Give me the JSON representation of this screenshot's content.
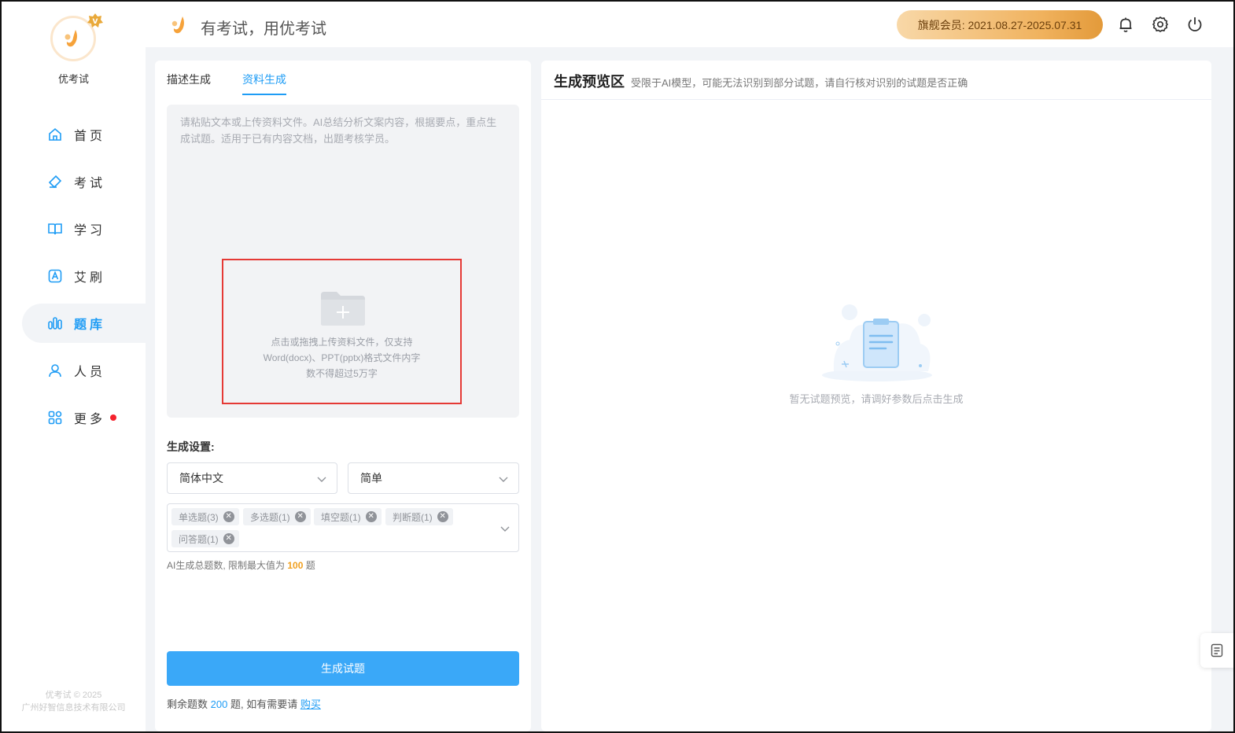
{
  "app": {
    "name": "优考试",
    "slogan": "有考试，用优考试",
    "copyright_line1": "优考试 © 2025",
    "copyright_line2": "广州好智信息技术有限公司"
  },
  "header": {
    "vip_text": "旗舰会员: 2021.08.27-2025.07.31",
    "icons": [
      "bell-icon",
      "gear-icon",
      "power-icon"
    ]
  },
  "sidebar": {
    "items": [
      {
        "label": "首页",
        "icon": "home-icon",
        "active": false
      },
      {
        "label": "考试",
        "icon": "eraser-icon",
        "active": false
      },
      {
        "label": "学习",
        "icon": "book-icon",
        "active": false
      },
      {
        "label": "艾刷",
        "icon": "a-letter-icon",
        "active": false
      },
      {
        "label": "题库",
        "icon": "bars-icon",
        "active": true
      },
      {
        "label": "人员",
        "icon": "user-icon",
        "active": false
      },
      {
        "label": "更多",
        "icon": "apps-icon",
        "active": false,
        "dot": true
      }
    ]
  },
  "left": {
    "tabs": [
      {
        "label": "描述生成",
        "active": false
      },
      {
        "label": "资料生成",
        "active": true
      }
    ],
    "placeholder": "请粘贴文本或上传资料文件。AI总结分析文案内容，根据要点，重点生成试题。适用于已有内容文档，出题考核学员。",
    "upload": {
      "line1": "点击或拖拽上传资料文件，仅支持",
      "line2": "Word(docx)、PPT(pptx)格式文件内字",
      "line3": "数不得超过5万字"
    },
    "settings_label": "生成设置:",
    "language_select": "简体中文",
    "difficulty_select": "简单",
    "tags": [
      "单选题(3)",
      "多选题(1)",
      "填空题(1)",
      "判断题(1)",
      "问答题(1)"
    ],
    "hint_prefix": "AI生成总题数, 限制最大值为",
    "hint_num": "100",
    "hint_suffix": "题",
    "generate_button": "生成试题",
    "remain_prefix": "剩余题数",
    "remain_num": "200",
    "remain_mid": "题, 如有需要请",
    "remain_link": "购买"
  },
  "right": {
    "title": "生成预览区",
    "subtitle": "受限于AI模型，可能无法识别到部分试题，请自行核对识别的试题是否正确",
    "empty_text": "暂无试题预览，请调好参数后点击生成"
  }
}
